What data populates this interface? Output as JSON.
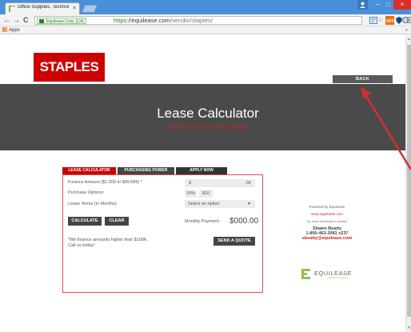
{
  "browser": {
    "tab_title": "Office Supplies, Technolo",
    "tab_close": "×",
    "nav": {
      "back": "←",
      "forward": "→",
      "reload": "C"
    },
    "ev_label": "Equilease Corp. [CA]",
    "url_scheme": "https",
    "url_rest": "://equilease.com",
    "url_path": "/vendor/staples/",
    "bookmarks_apps": "Apps",
    "bookmarks_more": "»",
    "window_buttons": {
      "minimize": "–",
      "maximize": "□",
      "close": "×"
    },
    "extension_icons": [
      "translate-icon",
      "star-icon",
      "off-extension-icon",
      "shield-extension-icon",
      "circle-extension-icon",
      "menu-icon"
    ]
  },
  "brand": {
    "logo_text": "STAPLES",
    "logo_color": "#cc0000"
  },
  "header": {
    "back_label": "BACK"
  },
  "hero": {
    "title": "Lease Calculator",
    "subtitle": "quickly calculate a lease payment"
  },
  "calculator": {
    "tabs": [
      "LEASE CALCULATOR",
      "PURCHASING POWER",
      "APPLY NOW"
    ],
    "finance_label": "Finance Amount ($1,500 to $99,999) *",
    "currency_symbol": "$",
    "cents": ".00",
    "purchase_label": "Purchase Options:",
    "purchase_options": [
      "10%",
      "$10"
    ],
    "term_label": "Lease Terms (in Months):",
    "term_value": "Select an option",
    "calculate_label": "CALCULATE",
    "clear_label": "CLEAR",
    "monthly_label": "Monthly Payment:",
    "monthly_value": "$000.00",
    "note_line1": "*We finance amounts higher than $100K.",
    "note_line2": "Call us today!",
    "send_quote_label": "SEND A QUOTE"
  },
  "sidebar": {
    "powered_by": "Powered by Equilease",
    "site": "www.equilease.com",
    "more_info": "for more information contact",
    "contact_name": "Shawn Beatty",
    "phone": "1-800-463-2081 x237",
    "email": "sbeatty@equilease.com",
    "partner_logo": "EQUILEASE",
    "partner_tagline": "Equipment Financing"
  },
  "annotation": {
    "arrow_color": "#d32f2f"
  }
}
